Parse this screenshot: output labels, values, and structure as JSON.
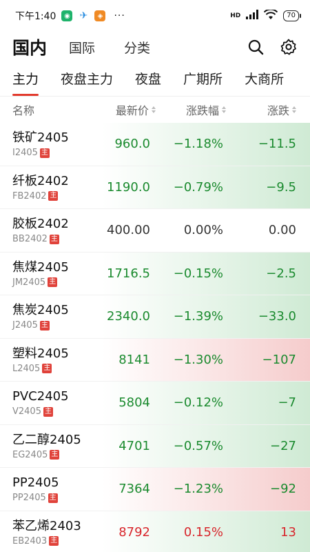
{
  "status_bar": {
    "time": "下午1:40",
    "dots": "···",
    "network": "HD",
    "battery": "70"
  },
  "top_nav": {
    "tabs": [
      {
        "label": "国内",
        "active": true
      },
      {
        "label": "国际",
        "active": false
      },
      {
        "label": "分类",
        "active": false
      }
    ]
  },
  "sub_tabs": [
    {
      "label": "主力",
      "active": true
    },
    {
      "label": "夜盘主力",
      "active": false
    },
    {
      "label": "夜盘",
      "active": false
    },
    {
      "label": "广期所",
      "active": false
    },
    {
      "label": "大商所",
      "active": false
    }
  ],
  "table_header": {
    "name": "名称",
    "price": "最新价",
    "pct": "涨跌幅",
    "chg": "涨跌"
  },
  "main_badge": "主",
  "rows": [
    {
      "name": "铁矿2405",
      "code": "I2405",
      "price": "960.0",
      "pct": "−1.18%",
      "chg": "−11.5",
      "trend": "green"
    },
    {
      "name": "纤板2402",
      "code": "FB2402",
      "price": "1190.0",
      "pct": "−0.79%",
      "chg": "−9.5",
      "trend": "green"
    },
    {
      "name": "胶板2402",
      "code": "BB2402",
      "price": "400.00",
      "pct": "0.00%",
      "chg": "0.00",
      "trend": "flat"
    },
    {
      "name": "焦煤2405",
      "code": "JM2405",
      "price": "1716.5",
      "pct": "−0.15%",
      "chg": "−2.5",
      "trend": "green"
    },
    {
      "name": "焦炭2405",
      "code": "J2405",
      "price": "2340.0",
      "pct": "−1.39%",
      "chg": "−33.0",
      "trend": "green"
    },
    {
      "name": "塑料2405",
      "code": "L2405",
      "price": "8141",
      "pct": "−1.30%",
      "chg": "−107",
      "trend": "red-bg"
    },
    {
      "name": "PVC2405",
      "code": "V2405",
      "price": "5804",
      "pct": "−0.12%",
      "chg": "−7",
      "trend": "green"
    },
    {
      "name": "乙二醇2405",
      "code": "EG2405",
      "price": "4701",
      "pct": "−0.57%",
      "chg": "−27",
      "trend": "green"
    },
    {
      "name": "PP2405",
      "code": "PP2405",
      "price": "7364",
      "pct": "−1.23%",
      "chg": "−92",
      "trend": "red-bg"
    },
    {
      "name": "苯乙烯2403",
      "code": "EB2403",
      "price": "8792",
      "pct": "0.15%",
      "chg": "13",
      "trend": "red"
    }
  ],
  "colors": {
    "up": "#d8262c",
    "down": "#1a8a2e",
    "accent": "#e23b2e"
  }
}
